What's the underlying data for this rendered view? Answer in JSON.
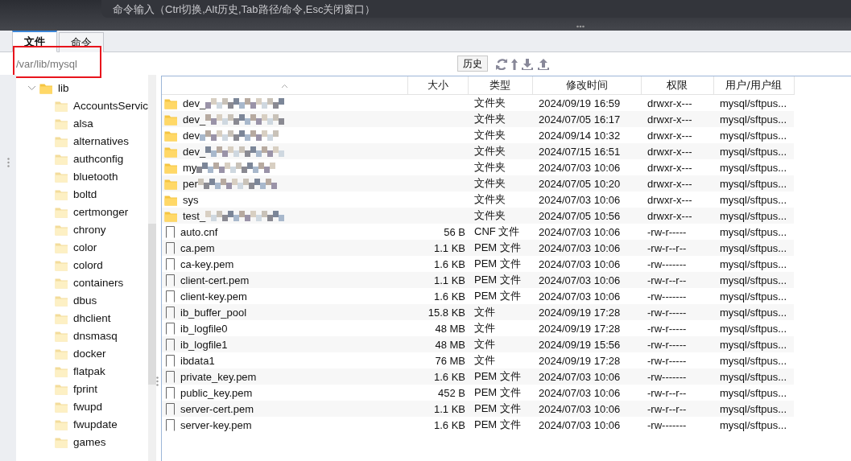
{
  "command_bar": {
    "placeholder": "命令输入（Ctrl切换,Alt历史,Tab路径/命令,Esc关闭窗口）"
  },
  "tabs": [
    {
      "label": "文件",
      "selected": true
    },
    {
      "label": "命令",
      "selected": false
    }
  ],
  "address": {
    "path": "/var/lib/mysql",
    "highlighted": true
  },
  "toolbar": {
    "history_button": "历史"
  },
  "tree": [
    {
      "label": "lib",
      "expanded": true,
      "children": [
        {
          "label": "AccountsServic"
        },
        {
          "label": "alsa"
        },
        {
          "label": "alternatives"
        },
        {
          "label": "authconfig"
        },
        {
          "label": "bluetooth"
        },
        {
          "label": "boltd"
        },
        {
          "label": "certmonger"
        },
        {
          "label": "chrony"
        },
        {
          "label": "color"
        },
        {
          "label": "colord"
        },
        {
          "label": "containers"
        },
        {
          "label": "dbus"
        },
        {
          "label": "dhclient"
        },
        {
          "label": "dnsmasq"
        },
        {
          "label": "docker"
        },
        {
          "label": "flatpak"
        },
        {
          "label": "fprint"
        },
        {
          "label": "fwupd"
        },
        {
          "label": "fwupdate"
        },
        {
          "label": "games"
        }
      ]
    }
  ],
  "table": {
    "columns": [
      "大小",
      "类型",
      "修改时间",
      "权限",
      "用户/用户组"
    ],
    "rows": [
      {
        "kind": "folder",
        "name": "dev_",
        "redacted": true,
        "size": "",
        "type": "文件夹",
        "modified": "2024/09/19 16:59",
        "perms": "drwxr-x---",
        "owner": "mysql/sftpus..."
      },
      {
        "kind": "folder",
        "name": "dev_",
        "redacted": true,
        "size": "",
        "type": "文件夹",
        "modified": "2024/07/05 16:17",
        "perms": "drwxr-x---",
        "owner": "mysql/sftpus..."
      },
      {
        "kind": "folder",
        "name": "dev",
        "redacted": true,
        "size": "",
        "type": "文件夹",
        "modified": "2024/09/14 10:32",
        "perms": "drwxr-x---",
        "owner": "mysql/sftpus..."
      },
      {
        "kind": "folder",
        "name": "dev_",
        "redacted": true,
        "size": "",
        "type": "文件夹",
        "modified": "2024/07/15 16:51",
        "perms": "drwxr-x---",
        "owner": "mysql/sftpus..."
      },
      {
        "kind": "folder",
        "name": "my",
        "redacted": true,
        "size": "",
        "type": "文件夹",
        "modified": "2024/07/03 10:06",
        "perms": "drwxr-x---",
        "owner": "mysql/sftpus..."
      },
      {
        "kind": "folder",
        "name": "per",
        "redacted": true,
        "size": "",
        "type": "文件夹",
        "modified": "2024/07/05 10:20",
        "perms": "drwxr-x---",
        "owner": "mysql/sftpus..."
      },
      {
        "kind": "folder",
        "name": "sys",
        "redacted": false,
        "size": "",
        "type": "文件夹",
        "modified": "2024/07/03 10:06",
        "perms": "drwxr-x---",
        "owner": "mysql/sftpus..."
      },
      {
        "kind": "folder",
        "name": "test_",
        "redacted": true,
        "size": "",
        "type": "文件夹",
        "modified": "2024/07/05 10:56",
        "perms": "drwxr-x---",
        "owner": "mysql/sftpus..."
      },
      {
        "kind": "file",
        "name": "auto.cnf",
        "redacted": false,
        "size": "56 B",
        "type": "CNF 文件",
        "modified": "2024/07/03 10:06",
        "perms": "-rw-r-----",
        "owner": "mysql/sftpus..."
      },
      {
        "kind": "file",
        "name": "ca.pem",
        "redacted": false,
        "size": "1.1 KB",
        "type": "PEM 文件",
        "modified": "2024/07/03 10:06",
        "perms": "-rw-r--r--",
        "owner": "mysql/sftpus..."
      },
      {
        "kind": "file",
        "name": "ca-key.pem",
        "redacted": false,
        "size": "1.6 KB",
        "type": "PEM 文件",
        "modified": "2024/07/03 10:06",
        "perms": "-rw-------",
        "owner": "mysql/sftpus..."
      },
      {
        "kind": "file",
        "name": "client-cert.pem",
        "redacted": false,
        "size": "1.1 KB",
        "type": "PEM 文件",
        "modified": "2024/07/03 10:06",
        "perms": "-rw-r--r--",
        "owner": "mysql/sftpus..."
      },
      {
        "kind": "file",
        "name": "client-key.pem",
        "redacted": false,
        "size": "1.6 KB",
        "type": "PEM 文件",
        "modified": "2024/07/03 10:06",
        "perms": "-rw-------",
        "owner": "mysql/sftpus..."
      },
      {
        "kind": "file",
        "name": "ib_buffer_pool",
        "redacted": false,
        "size": "15.8 KB",
        "type": "文件",
        "modified": "2024/09/19 17:28",
        "perms": "-rw-r-----",
        "owner": "mysql/sftpus..."
      },
      {
        "kind": "file",
        "name": "ib_logfile0",
        "redacted": false,
        "size": "48 MB",
        "type": "文件",
        "modified": "2024/09/19 17:28",
        "perms": "-rw-r-----",
        "owner": "mysql/sftpus..."
      },
      {
        "kind": "file",
        "name": "ib_logfile1",
        "redacted": false,
        "size": "48 MB",
        "type": "文件",
        "modified": "2024/09/19 15:56",
        "perms": "-rw-r-----",
        "owner": "mysql/sftpus..."
      },
      {
        "kind": "file",
        "name": "ibdata1",
        "redacted": false,
        "size": "76 MB",
        "type": "文件",
        "modified": "2024/09/19 17:28",
        "perms": "-rw-r-----",
        "owner": "mysql/sftpus..."
      },
      {
        "kind": "file",
        "name": "private_key.pem",
        "redacted": false,
        "size": "1.6 KB",
        "type": "PEM 文件",
        "modified": "2024/07/03 10:06",
        "perms": "-rw-------",
        "owner": "mysql/sftpus..."
      },
      {
        "kind": "file",
        "name": "public_key.pem",
        "redacted": false,
        "size": "452 B",
        "type": "PEM 文件",
        "modified": "2024/07/03 10:06",
        "perms": "-rw-r--r--",
        "owner": "mysql/sftpus..."
      },
      {
        "kind": "file",
        "name": "server-cert.pem",
        "redacted": false,
        "size": "1.1 KB",
        "type": "PEM 文件",
        "modified": "2024/07/03 10:06",
        "perms": "-rw-r--r--",
        "owner": "mysql/sftpus..."
      },
      {
        "kind": "file",
        "name": "server-key.pem",
        "redacted": false,
        "size": "1.6 KB",
        "type": "PEM 文件",
        "modified": "2024/07/03 10:06",
        "perms": "-rw-------",
        "owner": "mysql/sftpus..."
      }
    ]
  }
}
